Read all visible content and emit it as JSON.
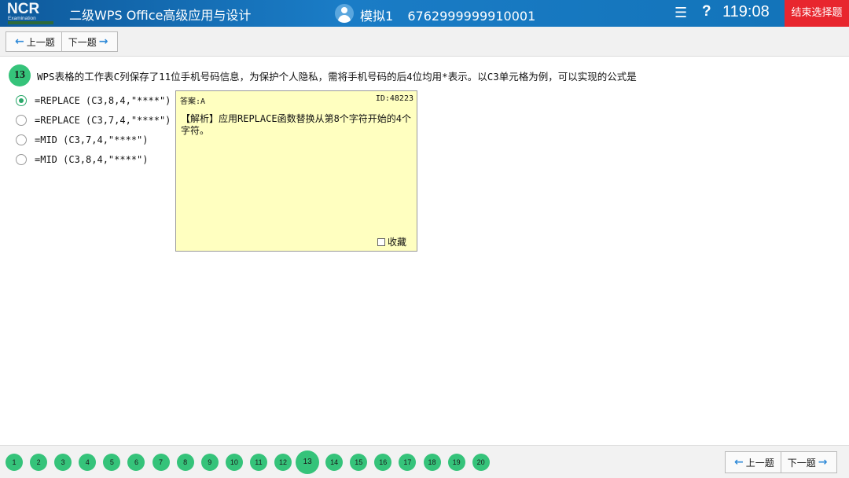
{
  "header": {
    "logo_text": "NCR",
    "logo_sub": "Examination",
    "app_title": "二级WPS Office高级应用与设计",
    "exam_name": "模拟1",
    "candidate_id": "6762999999910001",
    "timer": "119:08",
    "end_button": "结束选择题",
    "help_glyph": "?",
    "list_glyph": "☰",
    "icons": [
      "user-icon",
      "list-icon",
      "help-icon"
    ]
  },
  "toolbar": {
    "prev_label": "上一题",
    "next_label": "下一题"
  },
  "question": {
    "number": "13",
    "text": "WPS表格的工作表C列保存了11位手机号码信息，为保护个人隐私，需将手机号码的后4位均用*表示。以C3单元格为例，可以实现的公式是",
    "options": [
      {
        "text": "=REPLACE (C3,8,4,\"****\")",
        "selected": true
      },
      {
        "text": "=REPLACE (C3,7,4,\"****\")",
        "selected": false
      },
      {
        "text": "=MID (C3,7,4,\"****\")",
        "selected": false
      },
      {
        "text": "=MID (C3,8,4,\"****\")",
        "selected": false
      }
    ]
  },
  "answer_panel": {
    "answer": "答案:A",
    "id": "ID:48223",
    "analysis": "【解析】应用REPLACE函数替换从第8个字符开始的4个字符。",
    "favorite_label": "收藏",
    "background": "#ffffc0"
  },
  "pager": {
    "pages": [
      "1",
      "2",
      "3",
      "4",
      "5",
      "6",
      "7",
      "8",
      "9",
      "10",
      "11",
      "12",
      "13",
      "14",
      "15",
      "16",
      "17",
      "18",
      "19",
      "20"
    ],
    "current": "13"
  },
  "bottom": {
    "prev_label": "上一题",
    "next_label": "下一题"
  },
  "colors": {
    "header": "#1a7cc6",
    "end_button": "#e8262e",
    "accent_green": "#35c37a",
    "arrow_blue": "#2f8ad8"
  }
}
